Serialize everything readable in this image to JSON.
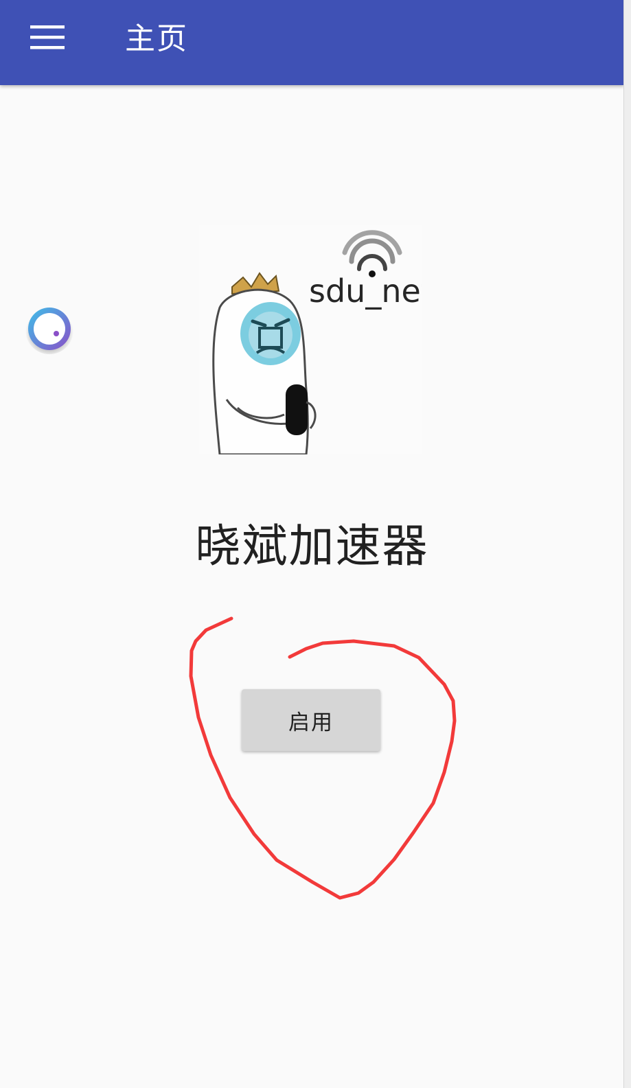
{
  "appbar": {
    "title": "主页",
    "menu_icon": "hamburger-menu-icon",
    "background": "#3f51b5"
  },
  "floating_assistant": {
    "icon": "floating-ball-icon"
  },
  "main": {
    "logo": {
      "icon": "mascot-wifi-logo-image",
      "text": "sdu_net"
    },
    "app_name": "晓斌加速器",
    "enable_button_label": "启用"
  },
  "annotation": {
    "color": "#f23a3a",
    "shape": "hand-drawn-circle"
  }
}
